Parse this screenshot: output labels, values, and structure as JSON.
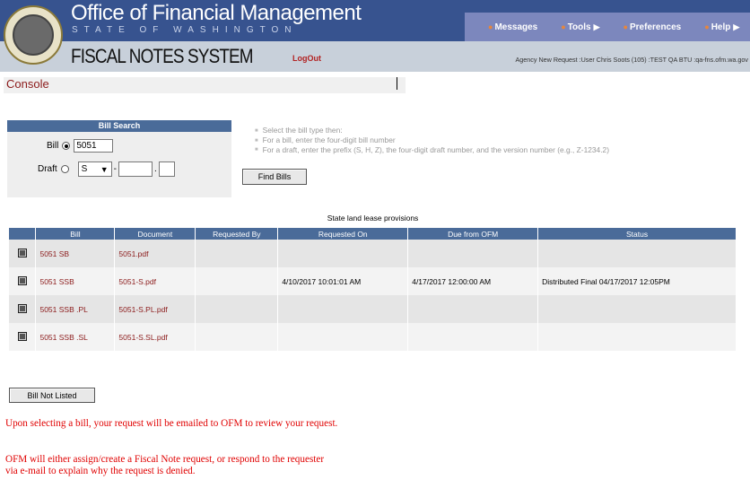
{
  "header": {
    "title": "Office of Financial Management",
    "subtitle": "STATE OF WASHINGTON",
    "system_title": "FISCAL NOTES SYSTEM",
    "logout_label": "LogOut",
    "agency_info": "Agency New Request :User Chris Soots (105) :TEST QA BTU :qa-fns.ofm.wa.gov",
    "colors": {
      "top_bar": "#37538f",
      "nav_menu": "#7c87bd",
      "sub_bar": "#c8d0da"
    }
  },
  "nav": {
    "items": [
      {
        "label": "Messages",
        "icon": "bullet-icon",
        "has_arrow": false
      },
      {
        "label": "Tools",
        "icon": "bullet-icon",
        "has_arrow": true
      },
      {
        "label": "Preferences",
        "icon": "bullet-icon",
        "has_arrow": false
      },
      {
        "label": "Help",
        "icon": "bullet-icon",
        "has_arrow": true
      }
    ]
  },
  "console": {
    "title": "Console"
  },
  "bill_search": {
    "header": "Bill Search",
    "bill_label": "Bill",
    "bill_value": "5051",
    "bill_selected": true,
    "draft_label": "Draft",
    "draft_selected": false,
    "draft_prefix": "S",
    "draft_number": "",
    "draft_version": "",
    "dash": "-",
    "dot": ".",
    "find_button": "Find Bills"
  },
  "instructions": [
    "Select the bill type then:",
    "For a bill, enter the four-digit bill number",
    "For a draft, enter the prefix (S, H, Z), the four-digit draft number, and the version number (e.g., Z-1234.2)"
  ],
  "results": {
    "caption": "State land lease provisions",
    "columns": [
      "",
      "Bill",
      "Document",
      "Requested By",
      "Requested On",
      "Due from OFM",
      "Status"
    ],
    "rows": [
      {
        "bill": "5051 SB",
        "document": "5051.pdf",
        "requested_by": "",
        "requested_on": "",
        "due": "",
        "status": ""
      },
      {
        "bill": "5051 SSB",
        "document": "5051-S.pdf",
        "requested_by": "",
        "requested_on": "4/10/2017 10:01:01 AM",
        "due": "4/17/2017 12:00:00 AM",
        "status": "Distributed Final 04/17/2017 12:05PM"
      },
      {
        "bill": "5051 SSB .PL",
        "document": "5051-S.PL.pdf",
        "requested_by": "",
        "requested_on": "",
        "due": "",
        "status": ""
      },
      {
        "bill": "5051 SSB .SL",
        "document": "5051-S.SL.pdf",
        "requested_by": "",
        "requested_on": "",
        "due": "",
        "status": ""
      }
    ]
  },
  "bill_not_listed_button": "Bill Not Listed",
  "notes": {
    "line1": "Upon selecting a bill, your request will be emailed to OFM to review your request.",
    "line2a": "OFM will either assign/create a Fiscal Note request, or respond to the requester",
    "line2b": "via e-mail to explain why the request is denied."
  }
}
